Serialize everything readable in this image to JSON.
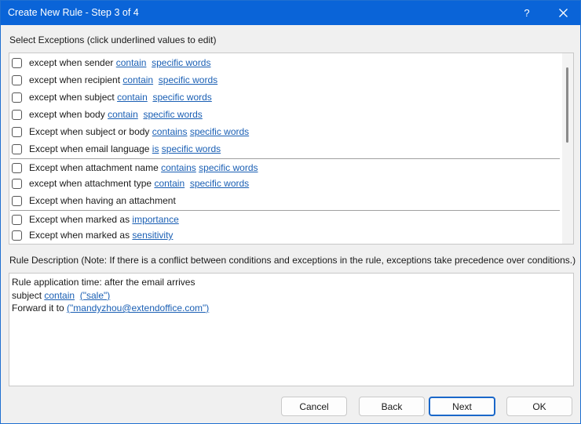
{
  "window": {
    "title": "Create New Rule - Step 3 of 4",
    "help_glyph": "?",
    "close_glyph": "✕"
  },
  "exceptions": {
    "label": "Select Exceptions (click underlined values to edit)",
    "items": [
      {
        "prefix": "except when sender ",
        "link1": "contain",
        "mid": "  ",
        "link2": "specific words",
        "checked": false
      },
      {
        "prefix": "except when recipient ",
        "link1": "contain",
        "mid": "  ",
        "link2": "specific words",
        "checked": false
      },
      {
        "prefix": "except when subject ",
        "link1": "contain",
        "mid": "  ",
        "link2": "specific words",
        "checked": false
      },
      {
        "prefix": "except when body ",
        "link1": "contain",
        "mid": "  ",
        "link2": "specific words",
        "checked": false
      },
      {
        "prefix": "Except when subject or body ",
        "link1": "contains",
        "mid": " ",
        "link2": "specific words",
        "checked": false
      },
      {
        "prefix": "Except when email language ",
        "link1": "is",
        "mid": " ",
        "link2": "specific words",
        "checked": false
      },
      {
        "prefix": "Except when attachment name ",
        "link1": "contains",
        "mid": " ",
        "link2": "specific words",
        "checked": false
      },
      {
        "prefix": "except when attachment type ",
        "link1": "contain",
        "mid": "  ",
        "link2": "specific words",
        "checked": false
      },
      {
        "prefix": "Except when having an attachment",
        "link1": "",
        "mid": "",
        "link2": "",
        "checked": false
      },
      {
        "prefix": "Except when marked as ",
        "link1": "importance",
        "mid": "",
        "link2": "",
        "checked": false
      },
      {
        "prefix": "Except when marked as ",
        "link1": "sensitivity",
        "mid": "",
        "link2": "",
        "checked": false
      }
    ]
  },
  "description": {
    "label": "Rule Description (Note: If there is a conflict between conditions and exceptions in the rule, exceptions take precedence over conditions.)",
    "line1": "Rule application time: after the email arrives",
    "line2_prefix": "subject ",
    "line2_link1": "contain",
    "line2_link2": "(\"sale\")",
    "line3_prefix": "Forward it to ",
    "line3_link": "(\"mandyzhou@extendoffice.com\")"
  },
  "buttons": {
    "cancel": "Cancel",
    "back": "Back",
    "next": "Next",
    "ok": "OK"
  },
  "colors": {
    "titlebar": "#0a64d8",
    "link": "#1a5fb4",
    "primary_border": "#1a67c9"
  }
}
